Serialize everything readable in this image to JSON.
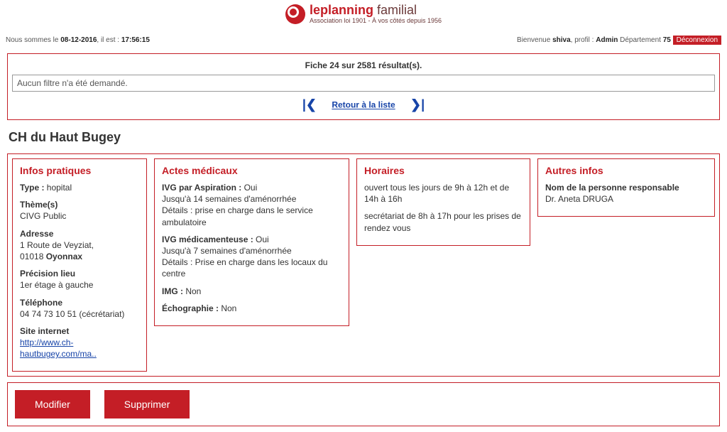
{
  "logo": {
    "title_red": "leplanning",
    "title_dark": " familial",
    "sub": "Association loi 1901 - À vos côtés depuis 1956"
  },
  "topbar": {
    "date_prefix": "Nous sommes le ",
    "date": "08-12-2016",
    "time_prefix": ", il est : ",
    "time": "17:56:15",
    "welcome": "Bienvenue ",
    "username": "shiva",
    "profile_label": ", profil : ",
    "profile": "Admin",
    "dept_label": " Département ",
    "dept": "75",
    "logout": "Déconnexion"
  },
  "results": {
    "header": "Fiche 24 sur 2581 résultat(s).",
    "filter_msg": "Aucun filtre n'a été demandé.",
    "back": "Retour à la liste"
  },
  "page_title": "CH du Haut Bugey",
  "infos": {
    "heading": "Infos pratiques",
    "type_label": "Type : ",
    "type": "hopital",
    "theme_label": "Thème(s)",
    "theme": "CIVG Public",
    "addr_label": "Adresse",
    "addr1": "1 Route de Veyziat,",
    "addr2_code": "01018 ",
    "addr2_city": "Oyonnax",
    "precision_label": "Précision lieu",
    "precision": "1er étage à gauche",
    "tel_label": "Téléphone",
    "tel": "04 74 73 10 51 (cécrétariat)",
    "site_label": "Site internet",
    "site": "http://www.ch-hautbugey.com/ma.."
  },
  "actes": {
    "heading": "Actes médicaux",
    "asp_label": "IVG par Aspiration : ",
    "asp_val": "Oui",
    "asp_line1": "Jusqu'à 14 semaines d'aménorrhée",
    "asp_line2": "Détails : prise en charge dans le service ambulatoire",
    "med_label": "IVG médicamenteuse : ",
    "med_val": "Oui",
    "med_line1": "Jusqu'à 7 semaines d'aménorrhée",
    "med_line2": "Détails : Prise en charge dans les locaux du centre",
    "img_label": "IMG : ",
    "img_val": "Non",
    "echo_label": "Échographie : ",
    "echo_val": "Non"
  },
  "horaires": {
    "heading": "Horaires",
    "line1": "ouvert tous les jours de 9h à 12h et de 14h à 16h",
    "line2": "secrétariat de 8h à 17h pour les prises de rendez vous"
  },
  "autres": {
    "heading": "Autres infos",
    "resp_label": "Nom de la personne responsable",
    "resp": "Dr. Aneta DRUGA"
  },
  "actions": {
    "modifier": "Modifier",
    "supprimer": "Supprimer"
  }
}
